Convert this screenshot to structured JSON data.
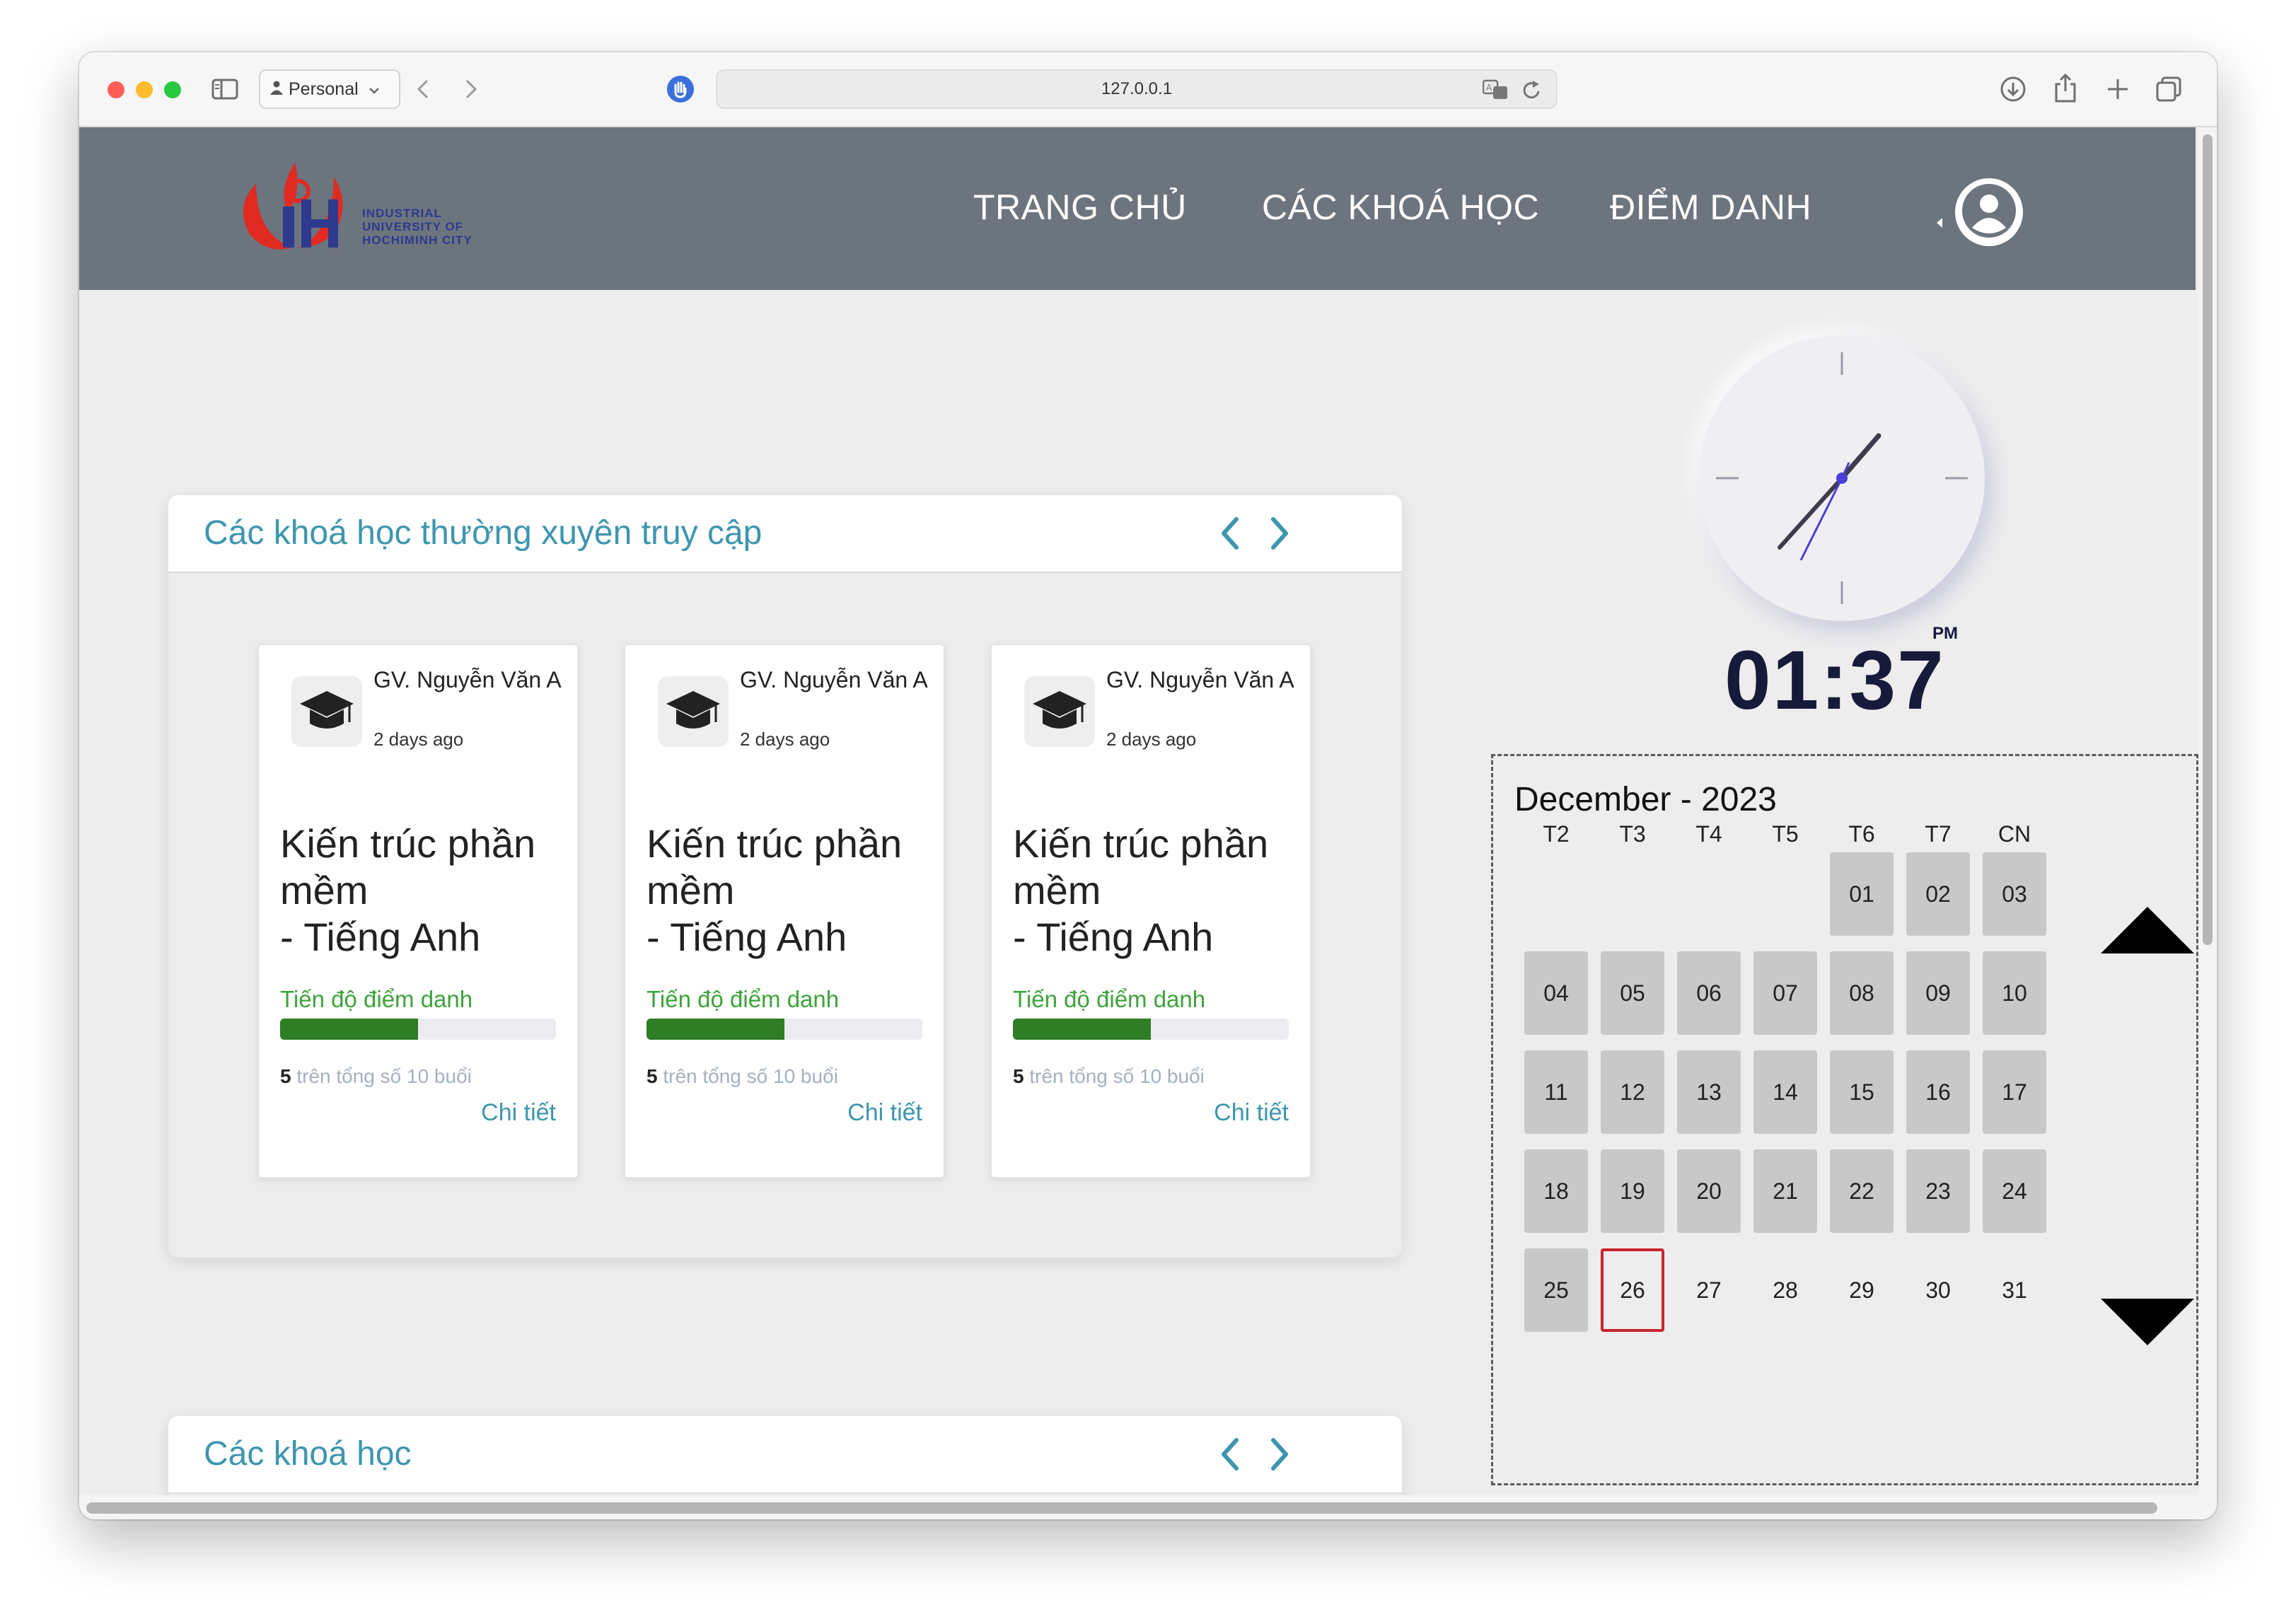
{
  "browser": {
    "profile_label": "Personal",
    "url": "127.0.0.1"
  },
  "site": {
    "logo_text_line1": "INDUSTRIAL",
    "logo_text_line2": "UNIVERSITY OF",
    "logo_text_line3": "HOCHIMINH CITY",
    "nav": [
      "TRANG CHỦ",
      "CÁC KHOÁ HỌC",
      "ĐIỂM DANH"
    ]
  },
  "frequent_panel": {
    "title": "Các khoá học thường xuyên truy cập",
    "cards": [
      {
        "teacher": "GV. Nguyễn Văn A",
        "time_ago": "2 days ago",
        "course_line1": "Kiến trúc phần mềm",
        "course_line2": "- Tiếng Anh",
        "progress_label": "Tiến độ điểm danh",
        "attended": "5",
        "sessions_text": " trên tổng số 10 buổi",
        "progress_fraction": 0.5,
        "detail_label": "Chi tiết"
      },
      {
        "teacher": "GV. Nguyễn Văn A",
        "time_ago": "2 days ago",
        "course_line1": "Kiến trúc phần mềm",
        "course_line2": "- Tiếng Anh",
        "progress_label": "Tiến độ điểm danh",
        "attended": "5",
        "sessions_text": " trên tổng số 10 buổi",
        "progress_fraction": 0.5,
        "detail_label": "Chi tiết"
      },
      {
        "teacher": "GV. Nguyễn Văn A",
        "time_ago": "2 days ago",
        "course_line1": "Kiến trúc phần mềm",
        "course_line2": "- Tiếng Anh",
        "progress_label": "Tiến độ điểm danh",
        "attended": "5",
        "sessions_text": " trên tổng số 10 buổi",
        "progress_fraction": 0.5,
        "detail_label": "Chi tiết"
      }
    ]
  },
  "courses_panel": {
    "title": "Các khoá học"
  },
  "clock": {
    "time": "01:37",
    "period": "PM"
  },
  "calendar": {
    "title": "December - 2023",
    "weekdays": [
      "T2",
      "T3",
      "T4",
      "T5",
      "T6",
      "T7",
      "CN"
    ],
    "first_weekday_index": 4,
    "days": [
      "01",
      "02",
      "03",
      "04",
      "05",
      "06",
      "07",
      "08",
      "09",
      "10",
      "11",
      "12",
      "13",
      "14",
      "15",
      "16",
      "17",
      "18",
      "19",
      "20",
      "21",
      "22",
      "23",
      "24",
      "25",
      "26",
      "27",
      "28",
      "29",
      "30",
      "31"
    ],
    "today": "26"
  },
  "colors": {
    "accent": "#3d96ae",
    "progress_green": "#2f7d24",
    "progress_label_green": "#3ea33a",
    "nav_bg": "#6c747e",
    "today_border": "#c8252b"
  }
}
